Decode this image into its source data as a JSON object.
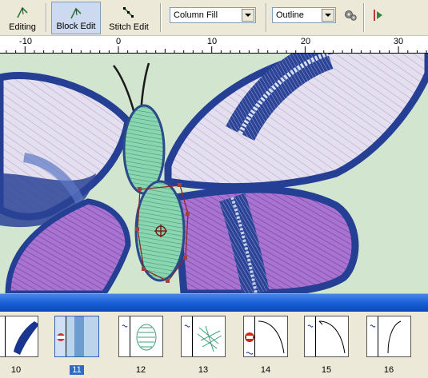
{
  "toolbar": {
    "editing_label": "Editing",
    "block_edit_label": "Block Edit",
    "stitch_edit_label": "Stitch Edit",
    "stitch_type_value": "Column Fill",
    "outline_type_value": "Outline"
  },
  "ruler": {
    "labels": [
      "-10",
      "0",
      "10",
      "20",
      "30"
    ]
  },
  "stitch_list": {
    "items": [
      {
        "number": "10",
        "selected": false
      },
      {
        "number": "11",
        "selected": true
      },
      {
        "number": "12",
        "selected": false
      },
      {
        "number": "13",
        "selected": false
      },
      {
        "number": "14",
        "selected": false
      },
      {
        "number": "15",
        "selected": false
      },
      {
        "number": "16",
        "selected": false
      }
    ]
  },
  "colors": {
    "canvas_bg": "#d2e6cf",
    "navy_stitch": "#233a8a",
    "purple_stitch": "#9a62c6",
    "body_green": "#7ccfa6",
    "scroll_blue": "#1a5fd6",
    "selected_blue": "#316ac5"
  }
}
